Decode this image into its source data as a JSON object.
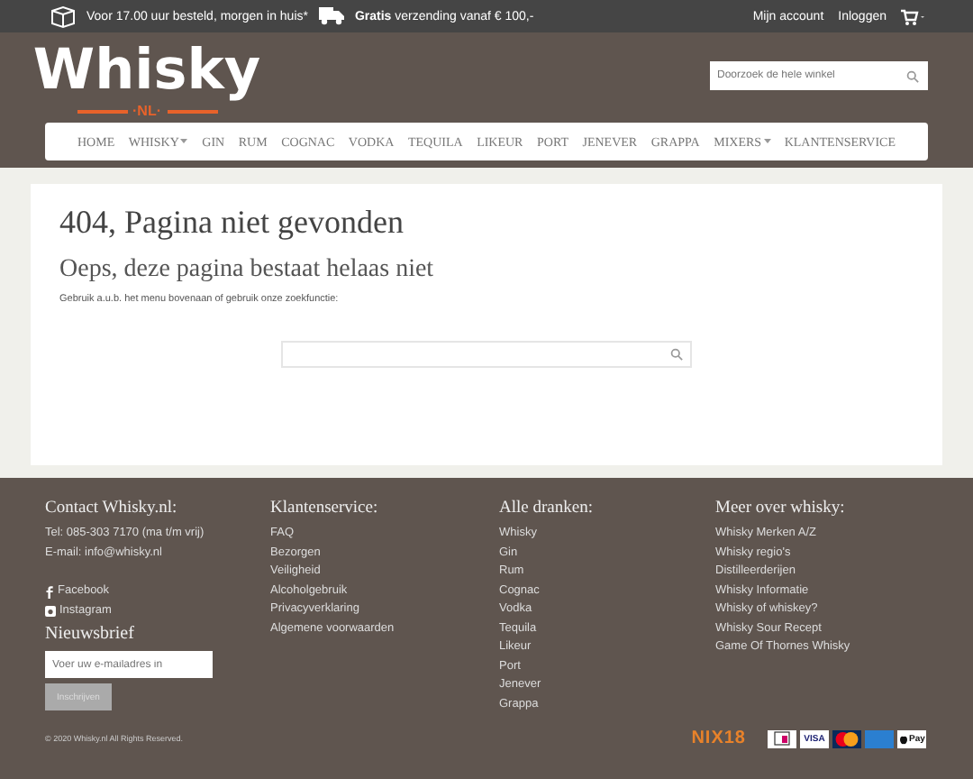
{
  "topbar": {
    "delivery": "Voor 17.00 uur besteld, morgen in huis*",
    "shipping_bold": "Gratis",
    "shipping": "verzending vanaf € 100,-",
    "links": [
      "Mijn account",
      "Inloggen"
    ]
  },
  "logo": {
    "word": "Whisky",
    "sub": "·NL·"
  },
  "search": {
    "placeholder": "Doorzoek de hele winkel"
  },
  "nav": [
    {
      "label": "HOME",
      "dropdown": false
    },
    {
      "label": "WHISKY",
      "dropdown": true
    },
    {
      "label": "GIN",
      "dropdown": false
    },
    {
      "label": "RUM",
      "dropdown": false
    },
    {
      "label": "COGNAC",
      "dropdown": false
    },
    {
      "label": "VODKA",
      "dropdown": false
    },
    {
      "label": "TEQUILA",
      "dropdown": false
    },
    {
      "label": "LIKEUR",
      "dropdown": false
    },
    {
      "label": "PORT",
      "dropdown": false
    },
    {
      "label": "JENEVER",
      "dropdown": false
    },
    {
      "label": "GRAPPA",
      "dropdown": false
    },
    {
      "label": "MIXERS",
      "dropdown": true
    },
    {
      "label": "KLANTENSERVICE",
      "dropdown": false
    }
  ],
  "main": {
    "title": "404, Pagina niet gevonden",
    "subtitle": "Oeps, deze pagina bestaat helaas niet",
    "text": "Gebruik a.u.b. het menu bovenaan of gebruik onze zoekfunctie:"
  },
  "footer": {
    "contact": {
      "title": "Contact Whisky.nl:",
      "lines": [
        "Tel: 085-303 7170 (ma t/m vrij)",
        "E-mail: info@whisky.nl"
      ],
      "social": [
        {
          "kind": "facebook",
          "label": "Facebook"
        },
        {
          "kind": "instagram",
          "label": "Instagram"
        }
      ]
    },
    "newsletter": {
      "title": "Nieuwsbrief",
      "placeholder": "Voer uw e-mailadres in",
      "button": "Inschrijven"
    },
    "columns": [
      {
        "title": "Klantenservice:",
        "links": [
          "FAQ",
          "Bezorgen",
          "Veiligheid",
          "Alcoholgebruik",
          "Privacyverklaring",
          "Algemene voorwaarden"
        ]
      },
      {
        "title": "Alle dranken:",
        "links": [
          "Whisky",
          "Gin",
          "Rum",
          "Cognac",
          "Vodka",
          "Tequila",
          "Likeur",
          "Port",
          "Jenever",
          "Grappa"
        ]
      },
      {
        "title": "Meer over whisky:",
        "links": [
          "Whisky Merken A/Z",
          "Whisky regio's",
          "Distilleerderijen",
          "Whisky Informatie",
          "Whisky of whiskey?",
          "Whisky Sour Recept",
          "Game Of Thornes Whisky"
        ]
      }
    ],
    "copyright": "© 2020 Whisky.nl All Rights Reserved.",
    "nix": "NIX18",
    "payments": [
      {
        "kind": "ideal"
      },
      {
        "kind": "visa",
        "label": "VISA"
      },
      {
        "kind": "mastercard"
      },
      {
        "kind": "amex"
      },
      {
        "kind": "applepay",
        "label": "Pay"
      }
    ]
  }
}
